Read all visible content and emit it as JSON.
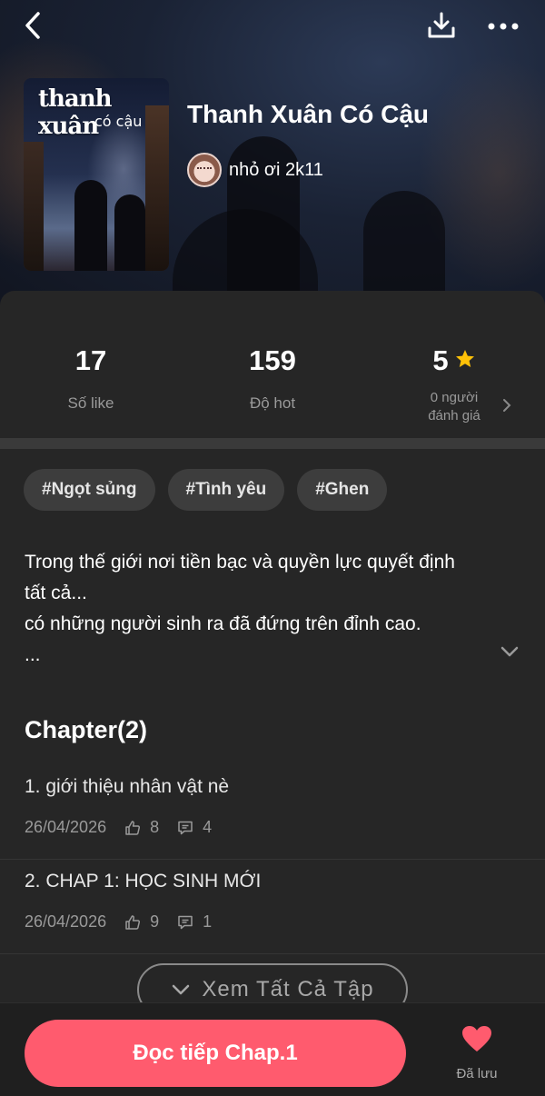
{
  "book": {
    "cover_title": "thanh xuân",
    "cover_subtitle": "có cậu",
    "title": "Thanh Xuân Có Cậu",
    "author": "nhỏ ơi 2k11"
  },
  "stats": {
    "likes": {
      "value": "17",
      "label": "Số like"
    },
    "hot": {
      "value": "159",
      "label": "Độ hot"
    },
    "rating": {
      "value": "5",
      "label_line1": "0 người",
      "label_line2": "đánh giá"
    }
  },
  "tags": [
    "#Ngọt sủng",
    "#Tình yêu",
    "#Ghen"
  ],
  "description": {
    "line1": "Trong thế giới nơi tiền bạc và quyền lực quyết định",
    "line2": "tất cả...",
    "line3": "có những người sinh ra đã đứng trên đỉnh cao.",
    "line4": "..."
  },
  "chapters": {
    "heading": "Chapter(2)",
    "items": [
      {
        "title": "1. giới thiệu nhân vật nè",
        "date": "26/04/2026",
        "likes": "8",
        "comments": "4"
      },
      {
        "title": "2. CHAP 1: HỌC SINH MỚI",
        "date": "26/04/2026",
        "likes": "9",
        "comments": "1"
      }
    ],
    "see_all_label": "Xem Tất Cả Tập"
  },
  "bottom": {
    "read_label": "Đọc tiếp Chap.1",
    "save_label": "Đã lưu"
  },
  "icons": {
    "back": "back-arrow-icon",
    "download": "download-icon",
    "more": "more-dots-icon",
    "star": "star-icon",
    "heart": "heart-icon"
  },
  "colors": {
    "accent": "#ff5b6e",
    "star": "#ffc107",
    "background": "#262626"
  }
}
